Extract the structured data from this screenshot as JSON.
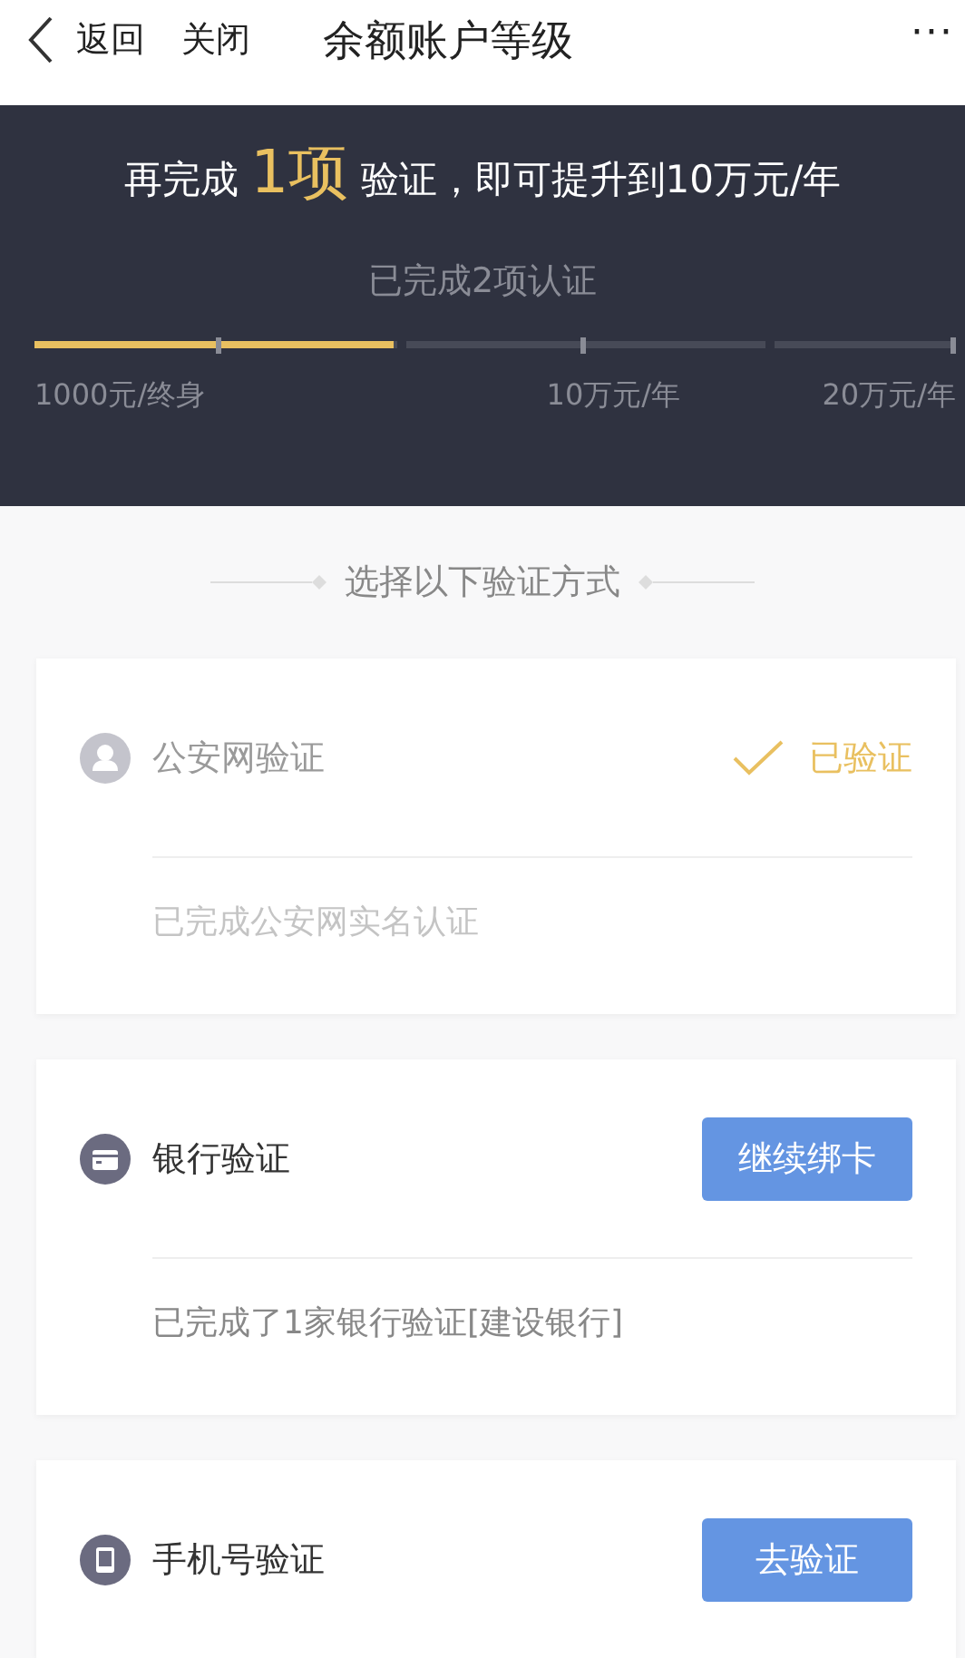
{
  "nav": {
    "back": "返回",
    "close": "关闭",
    "title": "余额账户等级",
    "more": "···"
  },
  "banner": {
    "headline": "再完成 **1项** 验证，即可提升到10万元/年",
    "progress_label": "已完成2项认证",
    "level": 0.39,
    "tiers": [
      "1000元/终身",
      "10万元/年",
      "20万元/年"
    ]
  },
  "section_title": "选择以下验证方式",
  "methods": [
    {
      "title": "公安网验证",
      "verified": true,
      "status": "已验证",
      "description": "已完成公安网实名认证"
    },
    {
      "title": "银行验证",
      "verified": false,
      "action": "继续绑卡",
      "description": "已完成了1家银行验证[建设银行]"
    },
    {
      "title": "手机号验证",
      "verified": false,
      "action": "去验证"
    }
  ]
}
